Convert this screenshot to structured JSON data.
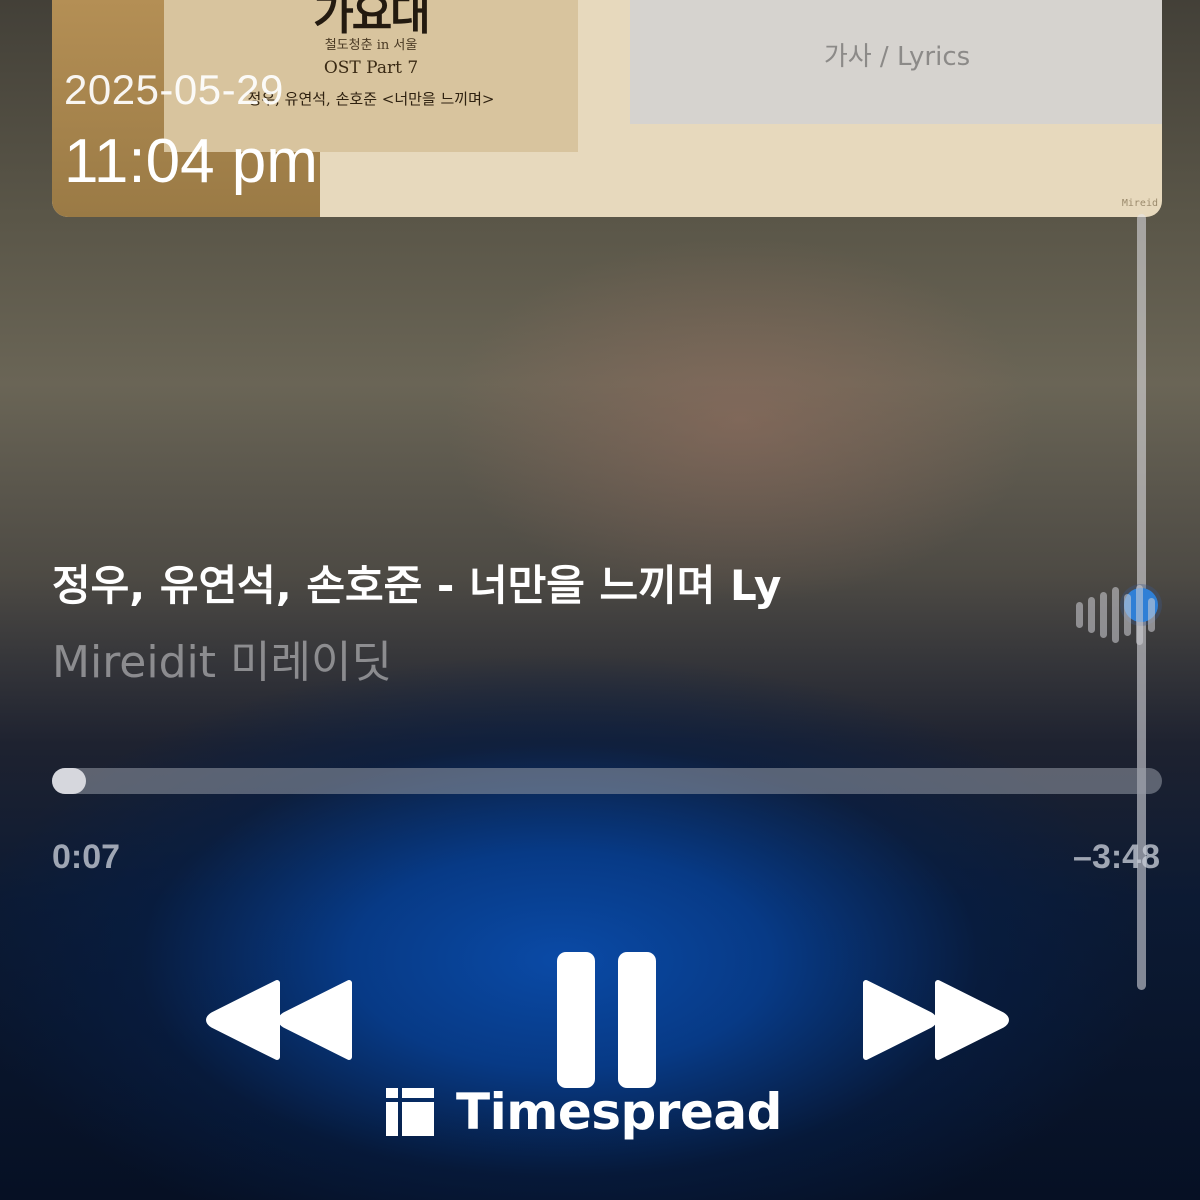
{
  "artwork": {
    "poster_title": "가요대",
    "poster_subtitle": "철도청춘 in 서울",
    "poster_ost": "OST Part 7",
    "poster_line": "정우, 유연석, 손호준 <너만을 느끼며>",
    "lyrics_label": "가사 / Lyrics",
    "mark": "Mireid"
  },
  "status": {
    "date": "2025-05-29",
    "time": "11:04 pm"
  },
  "now_playing": {
    "title": "정우, 유연석, 손호준 - 너만을 느끼며 Ly",
    "artist": "Mireidit 미레이딧",
    "progress_fraction": 0.03,
    "elapsed": "0:07",
    "remaining": "–3:48"
  },
  "controls": {
    "rewind_icon": "rewind-icon",
    "pause_icon": "pause-icon",
    "forward_icon": "fast-forward-icon"
  },
  "watermark": {
    "text": "Timespread"
  },
  "colors": {
    "accent_blue": "#2f7fd6",
    "control_white": "#ffffff"
  }
}
